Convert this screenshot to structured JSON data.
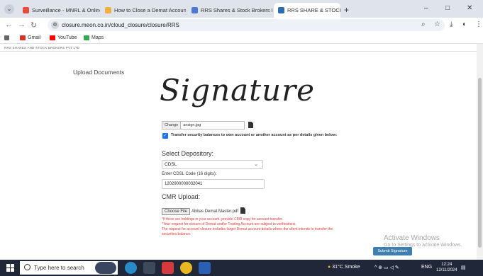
{
  "browser": {
    "tabs": [
      {
        "label": "Surveillance - MNRL & Online ·",
        "favicon_color": "#e84a3c"
      },
      {
        "label": "How to Close a Demat Accoun",
        "favicon_color": "#f2b13c"
      },
      {
        "label": "RRS Shares & Stock Brokers Pv",
        "favicon_color": "#4a7bd0"
      },
      {
        "label": "RRS SHARE & STOCK BROKERS",
        "favicon_color": "#2b6cb0",
        "active": true
      }
    ],
    "new_tab_symbol": "+",
    "window_controls": [
      "–",
      "□",
      "✕"
    ],
    "url": "closure.meon.co.in/cloud_closure/closure/RRS",
    "bookmarks": [
      {
        "label": "Gmail",
        "color": "#d93025"
      },
      {
        "label": "YouTube",
        "color": "#ff0000"
      },
      {
        "label": "Maps",
        "color": "#34a853"
      }
    ]
  },
  "page": {
    "brand_text": "RRS SHARES AND STOCK BROKERS PVT LTD",
    "upload_title": "Upload Documents",
    "signature_text": "Signature",
    "small_file": {
      "button": "Change",
      "filename": "ansign.jpg"
    },
    "checkbox_label": "Transfer security balances to own account or another account as per details given below:",
    "select_depository_label": "Select Depository:",
    "depository_value": "CDSL",
    "cdsl_code_label": "Enter CDSL Code (16 digits):",
    "cdsl_code_value": "1202900000032041",
    "cmr_label": "CMR Upload:",
    "cmr_file": {
      "button": "Choose File",
      "filename": "Abbas Demat Master.pdf"
    },
    "notes": [
      "*If there are holdings in your account, provide CMR copy for account transfer.",
      "*Your request for closure of Demat and/or Trading Account are subject to verifications.",
      "The request for account closure includes target Demat account details where the client intends to transfer the securities balance."
    ],
    "submit_label": "Submit Signature"
  },
  "watermark": {
    "title": "Activate Windows",
    "subtitle": "Go to Settings to activate Windows."
  },
  "taskbar": {
    "search_placeholder": "Type here to search",
    "weather": "31°C  Smoke",
    "language": "ENG",
    "time": "12:24",
    "date": "12/11/2024"
  }
}
